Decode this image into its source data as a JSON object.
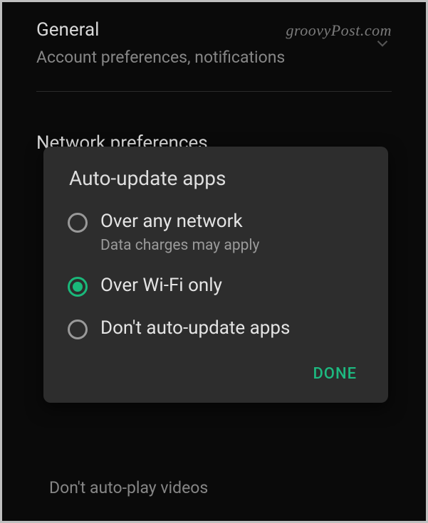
{
  "watermark": "groovyPost.com",
  "sections": {
    "general": {
      "title": "General",
      "subtitle": "Account preferences, notifications"
    },
    "network": {
      "title": "Network preferences"
    }
  },
  "dialog": {
    "title": "Auto-update apps",
    "options": [
      {
        "label": "Over any network",
        "sublabel": "Data charges may apply",
        "selected": false
      },
      {
        "label": "Over Wi-Fi only",
        "sublabel": "",
        "selected": true
      },
      {
        "label": "Don't auto-update apps",
        "sublabel": "",
        "selected": false
      }
    ],
    "done_label": "DONE"
  },
  "bottom_text": "Don't auto-play videos"
}
